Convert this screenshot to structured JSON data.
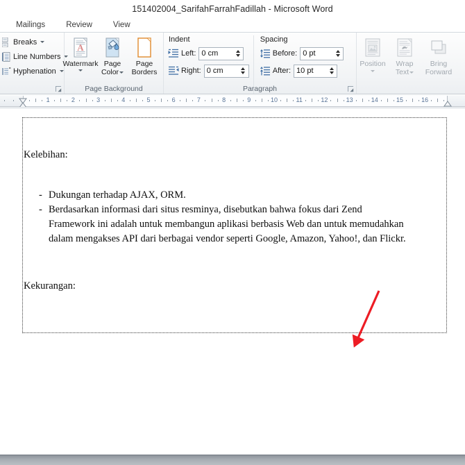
{
  "window": {
    "title": "151402004_SarifahFarrahFadillah  -  Microsoft Word"
  },
  "tabs": [
    {
      "label": "Mailings",
      "name": "tab-mailings"
    },
    {
      "label": "Review",
      "name": "tab-review"
    },
    {
      "label": "View",
      "name": "tab-view"
    }
  ],
  "ribbon": {
    "page_setup": {
      "items": [
        {
          "label": "Breaks",
          "icon": "page-breaks-icon"
        },
        {
          "label": "Line Numbers",
          "icon": "line-numbers-icon"
        },
        {
          "label": "Hyphenation",
          "icon": "hyphenation-icon"
        }
      ]
    },
    "page_background": {
      "label": "Page Background",
      "buttons": [
        {
          "label": "Watermark",
          "icon": "watermark-icon"
        },
        {
          "label_line1": "Page",
          "label_line2": "Color",
          "icon": "page-color-icon"
        },
        {
          "label_line1": "Page",
          "label_line2": "Borders",
          "icon": "page-borders-icon"
        }
      ]
    },
    "paragraph": {
      "label": "Paragraph",
      "indent": {
        "title": "Indent",
        "left_label": "Left:",
        "left_value": "0 cm",
        "right_label": "Right:",
        "right_value": "0 cm"
      },
      "spacing": {
        "title": "Spacing",
        "before_label": "Before:",
        "before_value": "0 pt",
        "after_label": "After:",
        "after_value": "10 pt"
      }
    },
    "arrange": {
      "buttons": [
        {
          "label_line1": "Position",
          "label_line2": "",
          "icon": "position-icon"
        },
        {
          "label_line1": "Wrap",
          "label_line2": "Text",
          "icon": "wrap-text-icon"
        },
        {
          "label_line1": "Bring",
          "label_line2": "Forward",
          "icon": "bring-forward-icon"
        }
      ]
    }
  },
  "ruler": {
    "numbers": [
      "1",
      "2",
      "3",
      "4",
      "5",
      "6",
      "7",
      "8",
      "9",
      "10",
      "11",
      "12",
      "13",
      "14",
      "15",
      "16"
    ]
  },
  "document": {
    "heading1": "Kelebihan:",
    "dash": "-",
    "bullets": [
      {
        "text": "Dukungan terhadap AJAX, ORM."
      },
      {
        "text": "Berdasarkan informasi dari situs resminya, disebutkan bahwa fokus dari Zend"
      }
    ],
    "continuation": [
      "Framework ini adalah untuk membangun aplikasi berbasis Web dan untuk memudahkan",
      "dalam mengakses API dari berbagai vendor seperti Google, Amazon, Yahoo!, dan Flickr."
    ],
    "heading2": "Kekurangan:"
  },
  "annotation": {
    "arrow_color": "#ED1C24",
    "arrow_name": "red-pointer-arrow"
  },
  "colors": {
    "ribbon_bg": "#f1f3f5",
    "ruler_num": "#5a7598",
    "group_label": "#5a6570"
  }
}
